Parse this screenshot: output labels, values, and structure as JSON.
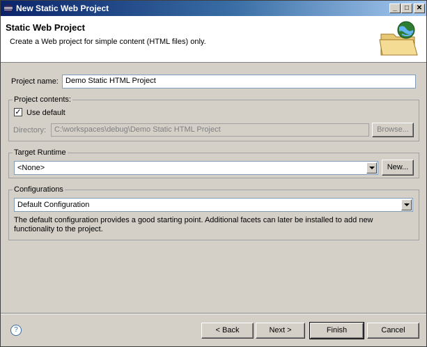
{
  "window": {
    "title": "New Static Web Project",
    "minimize_glyph": "_",
    "maximize_glyph": "□",
    "close_glyph": "✕"
  },
  "header": {
    "title": "Static Web Project",
    "description": "Create a Web project for simple content (HTML files) only."
  },
  "project_name": {
    "label": "Project name:",
    "value": "Demo Static HTML Project"
  },
  "project_contents": {
    "group_label": "Project contents:",
    "use_default_label": "Use default",
    "use_default_checked": true,
    "check_glyph": "✓",
    "directory_label": "Directory:",
    "directory_value": "C:\\workspaces\\debug\\Demo Static HTML Project",
    "browse_label": "Browse..."
  },
  "target_runtime": {
    "group_label": "Target Runtime",
    "selected": "<None>",
    "new_label": "New..."
  },
  "configurations": {
    "group_label": "Configurations",
    "selected": "Default Configuration",
    "description": "The default configuration provides a good starting point. Additional facets can later be installed to add new functionality to the project."
  },
  "footer": {
    "help_glyph": "?",
    "back_label": "< Back",
    "next_label": "Next >",
    "finish_label": "Finish",
    "cancel_label": "Cancel"
  },
  "colors": {
    "titlebar_start": "#0a246a",
    "titlebar_end": "#a6caf0",
    "dialog_bg": "#d4d0c8"
  }
}
